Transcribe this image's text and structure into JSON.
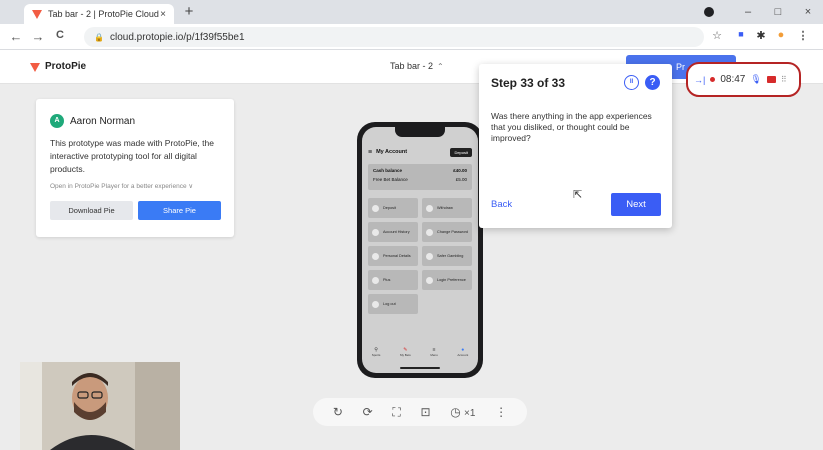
{
  "browser": {
    "tab_title": "Tab bar - 2 | ProtoPie Cloud",
    "tab_close": "×",
    "new_tab": "+",
    "url": "cloud.protopie.io/p/1f39f55be1",
    "win_minimize": "–",
    "win_restore": "□",
    "win_close": "×",
    "back": "←",
    "forward": "→",
    "reload": "C",
    "star": "☆",
    "menu": "⋮"
  },
  "app": {
    "brand": "ProtoPie",
    "pie_name": "Tab bar - 2",
    "pie_select_chevron": "⌃",
    "present_button": "Pr"
  },
  "info_card": {
    "author_initial": "A",
    "author_name": "Aaron Norman",
    "description": "This prototype was made with ProtoPie, the interactive prototyping tool for all digital products.",
    "open_player": "Open in ProtoPie Player for a better experience ∨",
    "download_label": "Download Pie",
    "share_label": "Share Pie"
  },
  "phone": {
    "title": "My Account",
    "deposit_label": "Deposit",
    "cash_label": "Cash balance",
    "cash_value": "£40.00",
    "free_label": "Free Bet Balance",
    "free_value": "£5.00",
    "tiles": [
      "Deposit",
      "Withdraw",
      "Account History",
      "Change Password",
      "Personal Details",
      "Safer Gambling",
      "Plus",
      "Login Preference",
      "Log out"
    ],
    "tabbar": [
      "Sports",
      "My Bets",
      "Menu",
      "Account"
    ]
  },
  "survey": {
    "step": "Step 33 of 33",
    "question": "Was there anything in the app experiences that you disliked, or thought could be improved?",
    "back_label": "Back",
    "next_label": "Next",
    "pause_symbol": "II",
    "help_symbol": "?"
  },
  "recorder": {
    "exit_symbol": "→|",
    "timer": "08:47",
    "grip_symbol": "⠿"
  },
  "player_controls": {
    "speed": "×1"
  }
}
